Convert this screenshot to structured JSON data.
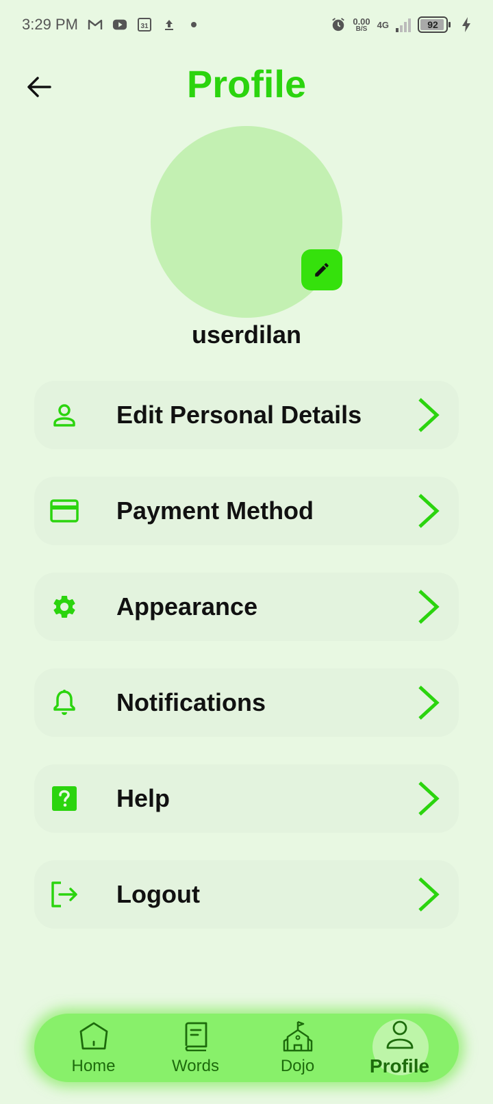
{
  "status_bar": {
    "time": "3:29 PM",
    "net_speed_value": "0.00",
    "net_speed_unit": "B/S",
    "network": "4G",
    "battery_level": "92",
    "icons": [
      "gmail-icon",
      "youtube-icon",
      "calendar-icon",
      "upload-icon",
      "dot-icon",
      "alarm-icon",
      "signal-icon",
      "battery-icon",
      "charging-icon"
    ],
    "calendar_day": "31"
  },
  "header": {
    "title": "Profile",
    "back_icon": "arrow-left-icon"
  },
  "profile": {
    "username": "userdilan",
    "avatar_color": "#c3f0b2",
    "edit_icon": "pencil-icon"
  },
  "menu": {
    "items": [
      {
        "label": "Edit Personal Details",
        "icon": "person-icon"
      },
      {
        "label": "Payment Method",
        "icon": "credit-card-icon"
      },
      {
        "label": "Appearance",
        "icon": "gear-icon"
      },
      {
        "label": "Notifications",
        "icon": "bell-icon"
      },
      {
        "label": "Help",
        "icon": "help-icon"
      },
      {
        "label": "Logout",
        "icon": "logout-icon"
      }
    ]
  },
  "bottom_nav": {
    "items": [
      {
        "label": "Home",
        "icon": "home-icon"
      },
      {
        "label": "Words",
        "icon": "book-icon"
      },
      {
        "label": "Dojo",
        "icon": "dojo-icon"
      },
      {
        "label": "Profile",
        "icon": "person-icon",
        "active": true
      }
    ]
  },
  "colors": {
    "background": "#e8f8e2",
    "accent": "#2bd40e",
    "accent_button": "#35e10c",
    "menu_item_bg": "#e3f3de",
    "nav_bg": "#88f06a",
    "nav_text": "#1d6b0c"
  }
}
